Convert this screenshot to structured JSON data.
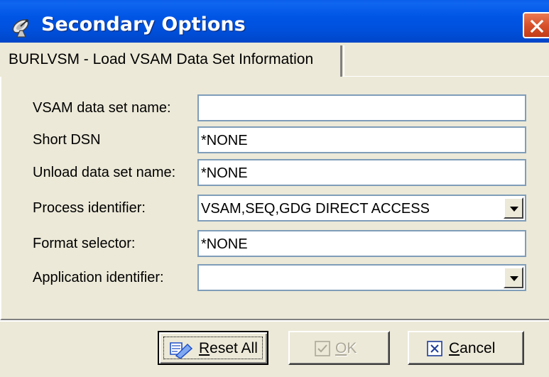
{
  "window": {
    "title": "Secondary Options"
  },
  "tabs": [
    {
      "label": "BURLVSM - Load VSAM Data Set Information",
      "selected": true
    }
  ],
  "form": {
    "fields": [
      {
        "label": "VSAM data set name:",
        "value": "",
        "type": "text"
      },
      {
        "label": "Short DSN",
        "value": "*NONE",
        "type": "text"
      },
      {
        "label": "Unload data set name:",
        "value": "*NONE",
        "type": "text"
      },
      {
        "label": "Process identifier:",
        "value": "VSAM,SEQ,GDG DIRECT ACCESS",
        "type": "dropdown"
      },
      {
        "label": "Format selector:",
        "value": "*NONE",
        "type": "text"
      },
      {
        "label": "Application identifier:",
        "value": "",
        "type": "dropdown"
      }
    ]
  },
  "buttons": {
    "reset": {
      "label": "Reset All",
      "icon": "reset-icon",
      "enabled": true
    },
    "ok": {
      "label": "OK",
      "icon": "check-icon",
      "enabled": false
    },
    "cancel": {
      "label": "Cancel",
      "icon": "x-box-icon",
      "enabled": true
    }
  },
  "colors": {
    "titlebar": "#0055E5",
    "window_bg": "#ECE9D8",
    "close_button": "#D8512A",
    "field_border": "#7F9DB9",
    "disabled_text": "#ACA899"
  }
}
